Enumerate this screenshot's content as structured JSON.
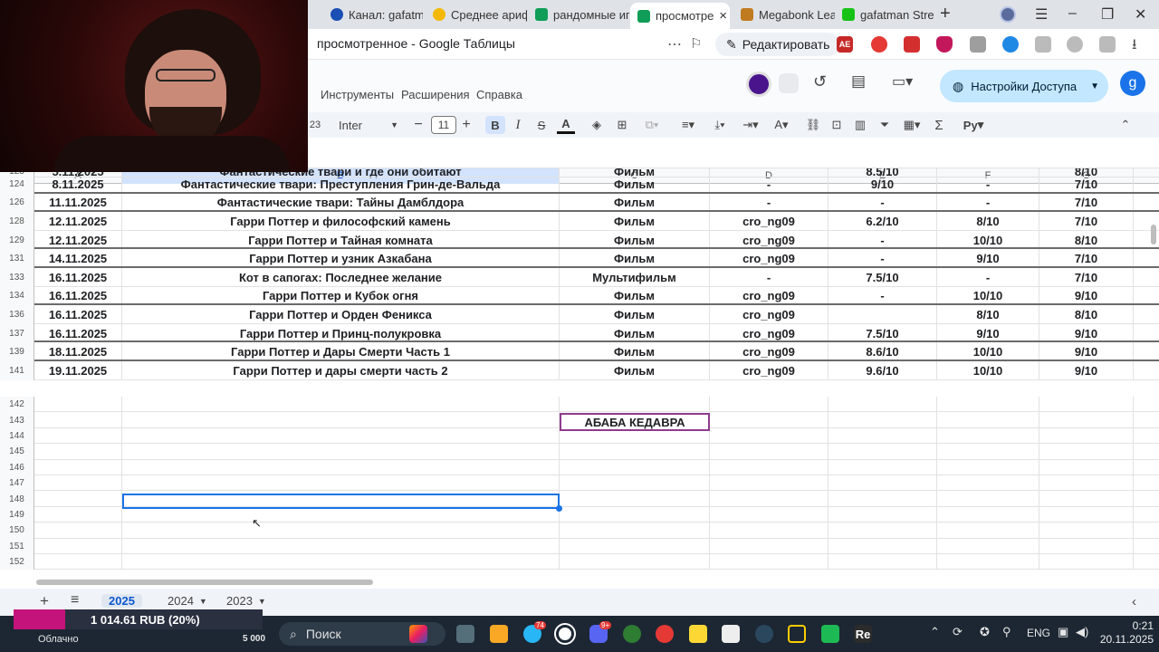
{
  "browser": {
    "tabs": [
      {
        "label": "Канал: gafatm",
        "color": "#1a4fb3"
      },
      {
        "label": "Среднее ариф",
        "color": "#f5b800"
      },
      {
        "label": "рандомные иг",
        "color": "#0f9d58"
      },
      {
        "label": "просмотре",
        "color": "#0f9d58",
        "active": true
      },
      {
        "label": "Megabonk Lea",
        "color": "#c07a20"
      },
      {
        "label": "gafatman Stre",
        "color": "#16c216"
      }
    ],
    "close_symbol": "×",
    "new_tab_symbol": "+",
    "page_title": "просмотренное - Google Таблицы",
    "edit_label": "Редактировать",
    "extension_badge": "AE"
  },
  "sheets": {
    "menus": [
      "Инструменты",
      "Расширения",
      "Справка"
    ],
    "share_label": "Настройки Доступа",
    "avatar_letter": "g",
    "toolbar": {
      "zoom_partial": "23",
      "font": "Inter",
      "size": "11",
      "bold": "B",
      "italic": "I",
      "strike": "S",
      "text_color": "A",
      "sum": "Σ",
      "lang": "Py"
    },
    "columns": [
      "A",
      "B",
      "C",
      "D",
      "E",
      "F",
      "G"
    ],
    "rows": [
      {
        "n": "123",
        "a": "5.11.2025",
        "b": "Фантастические твари и где они обитают",
        "c": "Фильм",
        "d": "",
        "e": "8.5/10",
        "f": "",
        "g": "8/10",
        "thick": false
      },
      {
        "n": "124",
        "a": "8.11.2025",
        "b": "Фантастические твари: Преступления Грин-де-Вальда",
        "c": "Фильм",
        "d": "-",
        "e": "9/10",
        "f": "-",
        "g": "7/10",
        "thick": true
      },
      {
        "n": "126",
        "a": "11.11.2025",
        "b": "Фантастические твари: Тайны Дамблдора",
        "c": "Фильм",
        "d": "-",
        "e": "-",
        "f": "-",
        "g": "7/10",
        "thick": true
      },
      {
        "n": "128",
        "a": "12.11.2025",
        "b": "Гарри Поттер и философский камень",
        "c": "Фильм",
        "d": "cro_ng09",
        "e": "6.2/10",
        "f": "8/10",
        "g": "7/10",
        "thick": false
      },
      {
        "n": "129",
        "a": "12.11.2025",
        "b": "Гарри Поттер и Тайная комната",
        "c": "Фильм",
        "d": "cro_ng09",
        "e": "-",
        "f": "10/10",
        "g": "8/10",
        "thick": true
      },
      {
        "n": "131",
        "a": "14.11.2025",
        "b": "Гарри Поттер и узник Азкабана",
        "c": "Фильм",
        "d": "cro_ng09",
        "e": "-",
        "f": "9/10",
        "g": "7/10",
        "thick": true
      },
      {
        "n": "133",
        "a": "16.11.2025",
        "b": "Кот в сапогах: Последнее желание",
        "c": "Мультифильм",
        "d": "-",
        "e": "7.5/10",
        "f": "-",
        "g": "7/10",
        "thick": false
      },
      {
        "n": "134",
        "a": "16.11.2025",
        "b": "Гарри Поттер и Кубок огня",
        "c": "Фильм",
        "d": "cro_ng09",
        "e": "-",
        "f": "10/10",
        "g": "9/10",
        "thick": true
      },
      {
        "n": "136",
        "a": "16.11.2025",
        "b": "Гарри Поттер и Орден Феникса",
        "c": "Фильм",
        "d": "cro_ng09",
        "e": "",
        "f": "8/10",
        "g": "8/10",
        "thick": false
      },
      {
        "n": "137",
        "a": "16.11.2025",
        "b": "Гарри Поттер и Принц-полукровка",
        "c": "Фильм",
        "d": "cro_ng09",
        "e": "7.5/10",
        "f": "9/10",
        "g": "9/10",
        "thick": true
      },
      {
        "n": "139",
        "a": "18.11.2025",
        "b": "Гарри Поттер и Дары Смерти Часть 1",
        "c": "Фильм",
        "d": "cro_ng09",
        "e": "8.6/10",
        "f": "10/10",
        "g": "9/10",
        "thick": true
      },
      {
        "n": "141",
        "a": "19.11.2025",
        "b": "Гарри Поттер и дары смерти часть 2",
        "c": "Фильм",
        "d": "cro_ng09",
        "e": "9.6/10",
        "f": "10/10",
        "g": "9/10",
        "thick": false
      }
    ],
    "empty_rows": [
      "142",
      "143",
      "144",
      "145",
      "146",
      "147",
      "148",
      "149",
      "150",
      "151",
      "152"
    ],
    "highlight_cell": "АБАБА КЕДАВРА",
    "sheet_tabs": [
      "2025",
      "2024",
      "2023"
    ],
    "add_sheet": "+",
    "all_sheets": "≡"
  },
  "overlay": {
    "donation_amount": "1 014.61 RUB (20%)",
    "donation_goal": "5 000"
  },
  "taskbar": {
    "weather": "Облачно",
    "search_label": "Поиск",
    "lang": "ENG",
    "time": "0:21",
    "date": "20.11.2025",
    "badge_telegram": "74",
    "badge_discord": "9+"
  }
}
